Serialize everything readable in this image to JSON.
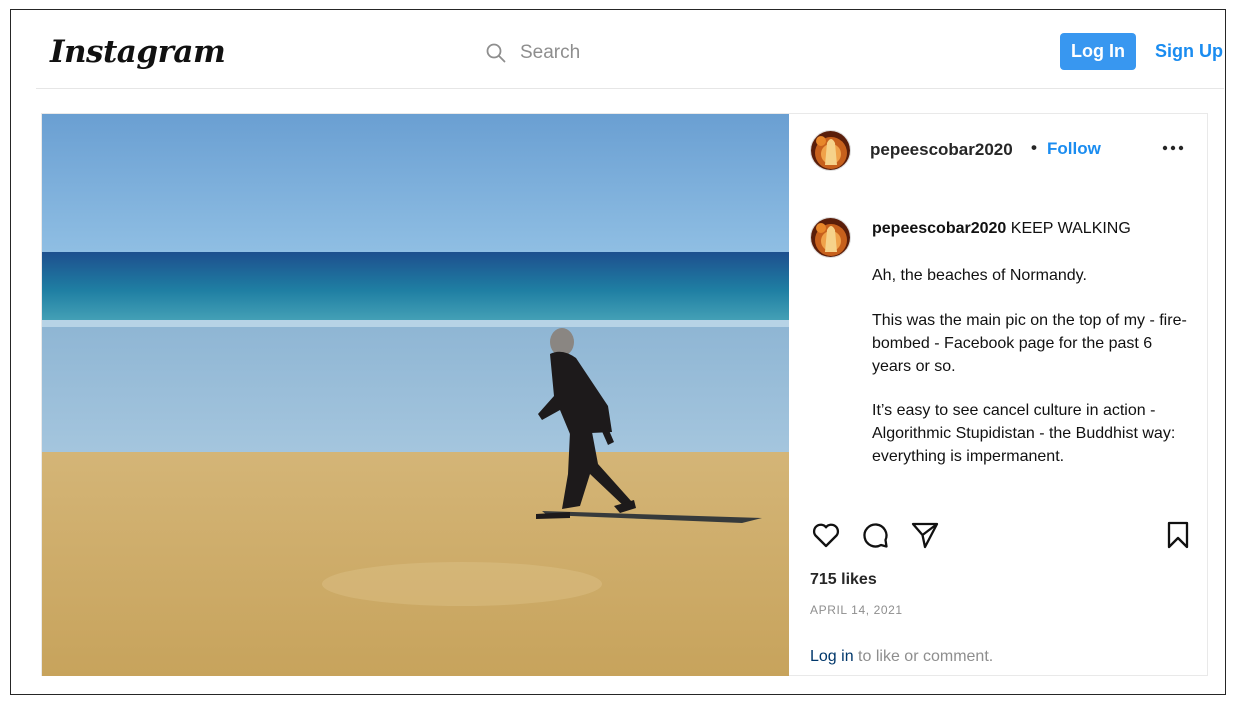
{
  "header": {
    "logo": "Instagram",
    "search_placeholder": "Search",
    "login_label": "Log In",
    "signup_label": "Sign Up",
    "search_icon": "search-icon"
  },
  "post": {
    "image_description_icon": "photo",
    "owner": {
      "username": "pepeescobar2020",
      "separator": "•",
      "follow_label": "Follow",
      "more_icon": "more-options-icon"
    },
    "caption": {
      "username": "pepeescobar2020",
      "title": "KEEP WALKING",
      "paragraphs": [
        "Ah, the beaches of Normandy.",
        "This was the main pic on the top of my - fire-bombed - Facebook page for the past 6 years or so.",
        "It’s easy to see cancel culture in action - Algorithmic Stupidistan - the Buddhist way: everything is impermanent."
      ]
    },
    "actions": {
      "like_icon": "heart-icon",
      "comment_icon": "comment-icon",
      "share_icon": "share-icon",
      "save_icon": "bookmark-icon"
    },
    "likes": "715 likes",
    "date": "APRIL 14, 2021",
    "comment_prompt": {
      "login_link": "Log in",
      "rest": "to like or comment."
    }
  },
  "colors": {
    "accent_blue": "#3897f0",
    "link_blue": "#1a8cf0",
    "muted_text": "#8e8e8e"
  }
}
